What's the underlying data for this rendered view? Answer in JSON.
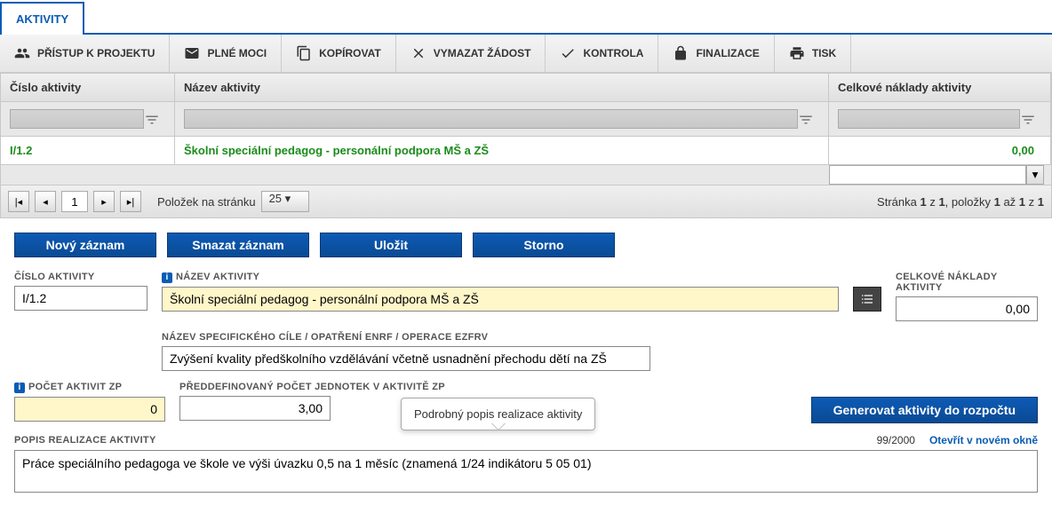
{
  "tabs": {
    "active": "AKTIVITY"
  },
  "toolbar": [
    {
      "icon": "people",
      "label": "PŘÍSTUP K PROJEKTU"
    },
    {
      "icon": "mail",
      "label": "PLNÉ MOCI"
    },
    {
      "icon": "copy",
      "label": "KOPÍROVAT"
    },
    {
      "icon": "cross",
      "label": "VYMAZAT ŽÁDOST"
    },
    {
      "icon": "check",
      "label": "KONTROLA"
    },
    {
      "icon": "lock",
      "label": "FINALIZACE"
    },
    {
      "icon": "print",
      "label": "TISK"
    }
  ],
  "grid": {
    "headers": {
      "num": "Číslo aktivity",
      "name": "Název aktivity",
      "cost": "Celkové náklady aktivity"
    },
    "row": {
      "num": "I/1.2",
      "name": "Školní speciální pedagog - personální podpora MŠ a ZŠ",
      "cost": "0,00"
    }
  },
  "pager": {
    "page": "1",
    "per_page_label": "Položek na stránku",
    "per_page": "25",
    "info_prefix": "Stránka ",
    "info_page": "1",
    "info_mid1": " z ",
    "info_pages": "1",
    "info_mid2": ", položky ",
    "info_from": "1",
    "info_mid3": " až ",
    "info_to": "1",
    "info_mid4": " z ",
    "info_total": "1"
  },
  "actions": {
    "new": "Nový záznam",
    "delete": "Smazat záznam",
    "save": "Uložit",
    "cancel": "Storno"
  },
  "form": {
    "cislo_label": "ČÍSLO AKTIVITY",
    "cislo_value": "I/1.2",
    "nazev_label": "NÁZEV AKTIVITY",
    "nazev_value": "Školní speciální pedagog - personální podpora MŠ a ZŠ",
    "celkove_label": "CELKOVÉ NÁKLADY AKTIVITY",
    "celkove_value": "0,00",
    "spec_label": "NÁZEV SPECIFICKÉHO CÍLE / OPATŘENÍ ENRF / OPERACE EZFRV",
    "spec_value": "Zvýšení kvality předškolního vzdělávání včetně usnadnění přechodu dětí na ZŠ",
    "pocet_label": "POČET AKTIVIT ZP",
    "pocet_value": "0",
    "preddef_label": "PŘEDDEFINOVANÝ POČET JEDNOTEK V AKTIVITĚ ZP",
    "preddef_value": "3,00",
    "generate": "Generovat aktivity do rozpočtu",
    "popis_label": "POPIS REALIZACE AKTIVITY",
    "popis_counter": "99/2000",
    "popis_link": "Otevřít v novém okně",
    "popis_value": "Práce speciálního pedagoga ve škole ve výši úvazku 0,5 na 1 měsíc (znamená 1/24 indikátoru 5 05 01)"
  },
  "tooltip": "Podrobný popis realizace aktivity"
}
